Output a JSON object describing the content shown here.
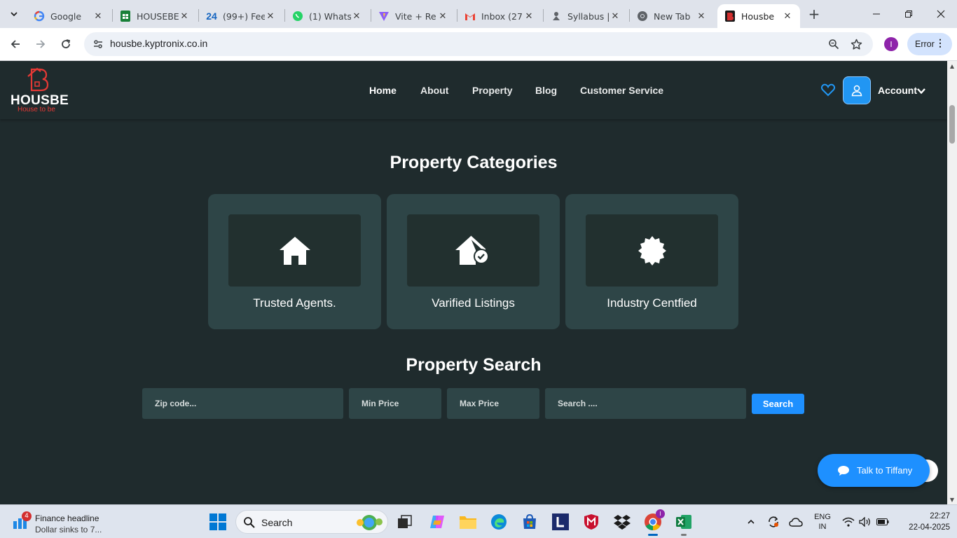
{
  "browser": {
    "tabs": [
      {
        "title": "Google",
        "icon": "google-icon"
      },
      {
        "title": "HOUSEBE",
        "icon": "sheets-icon"
      },
      {
        "title": "(99+) Fee",
        "icon": "app24-icon"
      },
      {
        "title": "(1) Whats",
        "icon": "whatsapp-icon"
      },
      {
        "title": "Vite + Re",
        "icon": "vite-icon"
      },
      {
        "title": "Inbox (27",
        "icon": "gmail-icon"
      },
      {
        "title": "Syllabus |",
        "icon": "syllabus-icon"
      },
      {
        "title": "New Tab",
        "icon": "chrome-icon"
      },
      {
        "title": "Housbe",
        "icon": "housbe-icon",
        "active": true
      }
    ],
    "url": "housbe.kyptronix.co.in",
    "profile_initial": "I",
    "error_label": "Error"
  },
  "site": {
    "brand": "HOUSBE",
    "tagline": "House to be",
    "nav": [
      "Home",
      "About",
      "Property",
      "Blog",
      "Customer Service"
    ],
    "account_label": "Account",
    "categories_title": "Property Categories",
    "categories": [
      {
        "label": "Trusted Agents.",
        "icon": "house-icon"
      },
      {
        "label": "Varified Listings",
        "icon": "house-check-icon"
      },
      {
        "label": "Industry Centfied",
        "icon": "certificate-badge-icon"
      }
    ],
    "search_title": "Property Search",
    "search": {
      "zip_placeholder": "Zip code...",
      "min_placeholder": "Min Price",
      "max_placeholder": "Max Price",
      "query_placeholder": "Search ....",
      "button": "Search"
    },
    "chat_label": "Talk to Tiffany",
    "colors": {
      "accent": "#1e90ff",
      "bg": "#1f2b2d",
      "card": "#2e4547",
      "brand_red": "#e53935"
    }
  },
  "taskbar": {
    "widget_title": "Finance headline",
    "widget_sub": "Dollar sinks to 7...",
    "widget_badge": "4",
    "search_label": "Search",
    "lang_line1": "ENG",
    "lang_line2": "IN",
    "time": "22:27",
    "date": "22-04-2025"
  }
}
